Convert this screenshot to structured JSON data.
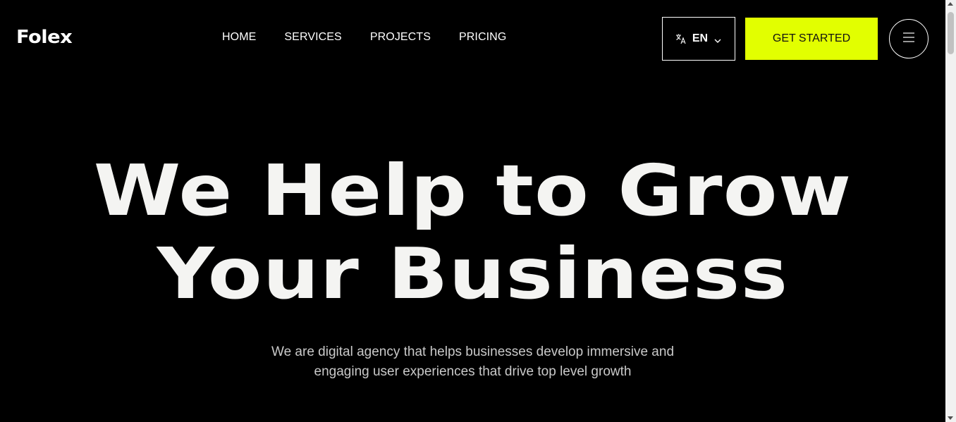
{
  "brand": {
    "name": "Folex"
  },
  "nav": {
    "items": [
      {
        "label": "HOME"
      },
      {
        "label": "SERVICES"
      },
      {
        "label": "PROJECTS"
      },
      {
        "label": "PRICING"
      }
    ]
  },
  "language": {
    "label": "EN",
    "icon": "translate-icon"
  },
  "cta": {
    "label": "GET STARTED"
  },
  "menu": {
    "icon": "hamburger-icon"
  },
  "hero": {
    "title_line1": "We Help to Grow",
    "title_line2": "Your Business",
    "subtitle_line1": "We are digital agency that helps businesses develop immersive and",
    "subtitle_line2": "engaging user experiences that drive top level growth"
  },
  "colors": {
    "background": "#000000",
    "accent": "#e2ff00",
    "text": "#ffffff",
    "hero_text": "#f4f4f2",
    "subtitle_text": "#c9c9c9"
  }
}
